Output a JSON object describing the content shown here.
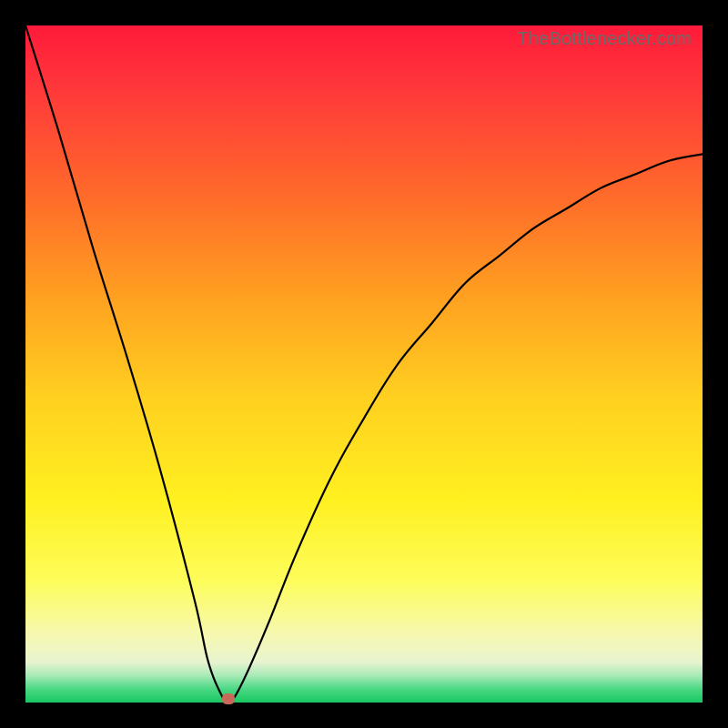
{
  "attribution": "TheBottlenecker.com",
  "chart_data": {
    "type": "line",
    "title": "",
    "xlabel": "",
    "ylabel": "",
    "xlim": [
      0,
      100
    ],
    "ylim": [
      0,
      100
    ],
    "series": [
      {
        "name": "bottleneck-curve",
        "x": [
          0,
          5,
          10,
          15,
          20,
          25,
          27,
          29,
          30,
          31,
          33,
          36,
          40,
          45,
          50,
          55,
          60,
          65,
          70,
          75,
          80,
          85,
          90,
          95,
          100
        ],
        "values": [
          100,
          84,
          67,
          51,
          34,
          15,
          6,
          1,
          0,
          1,
          5,
          12,
          22,
          33,
          42,
          50,
          56,
          62,
          66,
          70,
          73,
          76,
          78,
          80,
          81
        ]
      }
    ],
    "marker": {
      "x": 30,
      "y": 0
    },
    "gradient_stops": [
      {
        "pos": 0,
        "color": "#ff1a3a"
      },
      {
        "pos": 50,
        "color": "#ffe020"
      },
      {
        "pos": 100,
        "color": "#18c760"
      }
    ]
  }
}
